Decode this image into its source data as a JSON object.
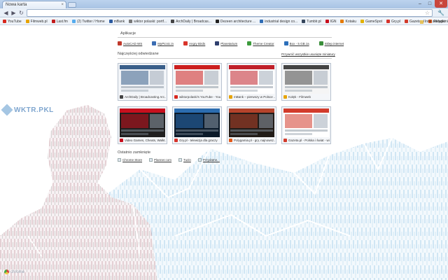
{
  "window": {
    "tab_title": "Nowa karta",
    "tab_close": "×",
    "controls": {
      "minimize": "–",
      "maximize": "□",
      "close": "✕"
    }
  },
  "toolbar": {
    "back": "◀",
    "forward": "▶",
    "reload": "↻",
    "address_value": "",
    "star": "☆",
    "menu": "🔧"
  },
  "bookmarks": {
    "items": [
      {
        "label": "YouTube",
        "color": "#d8281e"
      },
      {
        "label": "Filmweb.pl",
        "color": "#e6a300"
      },
      {
        "label": "Last.fm",
        "color": "#c21c1c"
      },
      {
        "label": "(2) Twitter / Home",
        "color": "#55acee"
      },
      {
        "label": "mBank",
        "color": "#2b5aa0"
      },
      {
        "label": "wiktor polaski: portf...",
        "color": "#777777"
      },
      {
        "label": "ArchDaily | Broadcas...",
        "color": "#444444"
      },
      {
        "label": "Dezeen architecture ...",
        "color": "#222222"
      },
      {
        "label": "industrial design co...",
        "color": "#2f6db5"
      },
      {
        "label": "Tumblr.pl",
        "color": "#35465c"
      },
      {
        "label": "IGN",
        "color": "#c8101e"
      },
      {
        "label": "Kotaku",
        "color": "#e47a00"
      },
      {
        "label": "GameSpot",
        "color": "#e2b100"
      },
      {
        "label": "Gry.pl",
        "color": "#d6332b"
      },
      {
        "label": "Gazeta.pl",
        "color": "#d23b2b"
      },
      {
        "label": "Polygamia.pl",
        "color": "#e35a1a"
      },
      {
        "label": "Skype",
        "color": "#00aff0"
      },
      {
        "label": "Wikiteka.pl",
        "color": "#666666"
      }
    ],
    "other_label": "Inne zakładki"
  },
  "apps": {
    "heading": "Aplikacje",
    "items": [
      {
        "label": "AutoCAD WS",
        "color": "#c0392b"
      },
      {
        "label": "MyPicnic.in",
        "color": "#3b6db3"
      },
      {
        "label": "Angry Birds",
        "color": "#d9342b"
      },
      {
        "label": "Planetarium",
        "color": "#2f3f6e"
      },
      {
        "label": "Theme Creator",
        "color": "#3c9b3c"
      },
      {
        "label": "Box - 5 GB za",
        "color": "#2c6fba"
      },
      {
        "label": "Sklep internet",
        "color": "#3a8e3a"
      }
    ]
  },
  "most_visited": {
    "heading": "Najczęściej odwiedzane",
    "restore_label": "Przywróć wszystkie usunięte miniatury",
    "tiles": [
      {
        "caption": "ArchDaily | Broadcasting Arc...",
        "favicon_color": "#444444",
        "shot_bg": "#f0f3f7",
        "shot_accent": "#3a5f8a"
      },
      {
        "caption": "wiktorpolaski's YouTube - Your...",
        "favicon_color": "#d8281e",
        "shot_bg": "#f7f7f7",
        "shot_accent": "#cc1f1f"
      },
      {
        "caption": "mBank – pierwszy w Polsce ...",
        "favicon_color": "#e6a300",
        "shot_bg": "#ffffff",
        "shot_accent": "#c0202a"
      },
      {
        "caption": "Kołęk - Filmweb",
        "favicon_color": "#e6a300",
        "shot_bg": "#f5f5f5",
        "shot_accent": "#444444"
      },
      {
        "caption": "Video Games, Cheats, Walkt...",
        "favicon_color": "#c8101e",
        "shot_bg": "#1f1f1f",
        "shot_accent": "#c8101e"
      },
      {
        "caption": "Gry.pl - telewizja dla graczy",
        "favicon_color": "#d6332b",
        "shot_bg": "#0b1a2a",
        "shot_accent": "#2c6db0"
      },
      {
        "caption": "Polygamia.pl - gry, najnowsz...",
        "favicon_color": "#e35a1a",
        "shot_bg": "#221c18",
        "shot_accent": "#b5432b"
      },
      {
        "caption": "Gazeta.pl - Polska i świat - wi...",
        "favicon_color": "#d23b2b",
        "shot_bg": "#ffffff",
        "shot_accent": "#d23b2b"
      }
    ]
  },
  "recently_closed": {
    "heading": "Ostatnio zamknięte",
    "items": [
      {
        "label": "Chrome Store"
      },
      {
        "label": "Planner.com"
      },
      {
        "label": "Tuzin"
      },
      {
        "label": "Przydatne..."
      }
    ]
  },
  "theme": {
    "logo_text": "WKTR.PKL",
    "chrome_mark": "chrome"
  }
}
